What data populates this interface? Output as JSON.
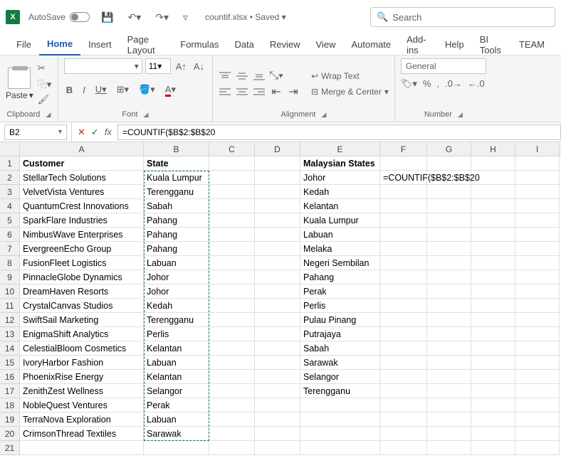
{
  "title": {
    "autosave": "AutoSave",
    "filename": "countif.xlsx • Saved ",
    "search_placeholder": "Search"
  },
  "tabs": [
    "File",
    "Home",
    "Insert",
    "Page Layout",
    "Formulas",
    "Data",
    "Review",
    "View",
    "Automate",
    "Add-ins",
    "Help",
    "BI Tools",
    "TEAM"
  ],
  "active_tab": "Home",
  "ribbon": {
    "clipboard": {
      "paste": "Paste",
      "label": "Clipboard"
    },
    "font": {
      "size": "11",
      "b": "B",
      "i": "I",
      "u": "U",
      "label": "Font"
    },
    "alignment": {
      "wrap": "Wrap Text",
      "merge": "Merge & Center",
      "label": "Alignment"
    },
    "number": {
      "format": "General",
      "label": "Number"
    }
  },
  "namebox": "B2",
  "formula": "=COUNTIF($B$2:$B$20",
  "columns": [
    "A",
    "B",
    "C",
    "D",
    "E",
    "F",
    "G",
    "H",
    "I"
  ],
  "headers": {
    "a1": "Customer",
    "b1": "State",
    "e1": "Malaysian States"
  },
  "customers": [
    "StellarTech Solutions",
    "VelvetVista Ventures",
    "QuantumCrest Innovations",
    "SparkFlare Industries",
    "NimbusWave Enterprises",
    "EvergreenEcho Group",
    "FusionFleet Logistics",
    "PinnacleGlobe Dynamics",
    "DreamHaven Resorts",
    "CrystalCanvas Studios",
    "SwiftSail Marketing",
    "EnigmaShift Analytics",
    "CelestialBloom Cosmetics",
    "IvoryHarbor Fashion",
    "PhoenixRise Energy",
    "ZenithZest Wellness",
    "NobleQuest Ventures",
    "TerraNova Exploration",
    "CrimsonThread Textiles"
  ],
  "states": [
    "Kuala Lumpur",
    "Terengganu",
    "Sabah",
    "Pahang",
    "Pahang",
    "Pahang",
    "Labuan",
    "Johor",
    "Johor",
    "Kedah",
    "Terengganu",
    "Perlis",
    "Kelantan",
    "Labuan",
    "Kelantan",
    "Selangor",
    "Perak",
    "Labuan",
    "Sarawak"
  ],
  "mstates": [
    "Johor",
    "Kedah",
    "Kelantan",
    "Kuala Lumpur",
    "Labuan",
    "Melaka",
    "Negeri Sembilan",
    "Pahang",
    "Perak",
    "Perlis",
    "Pulau Pinang",
    "Putrajaya",
    "Sabah",
    "Sarawak",
    "Selangor",
    "Terengganu"
  ],
  "f2": "=COUNTIF($B$2:$B$20"
}
